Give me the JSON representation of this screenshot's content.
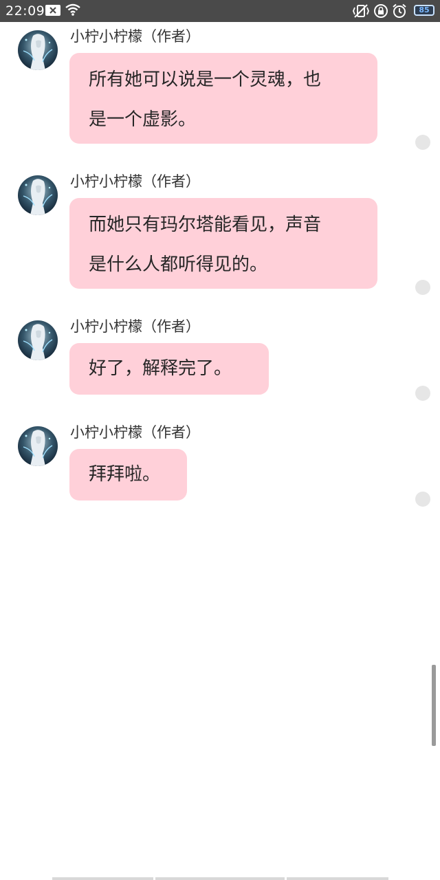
{
  "status_bar": {
    "time": "22:09",
    "battery": "85",
    "icons": [
      "close-box-icon",
      "wifi-icon",
      "vibrate-icon",
      "lock-rotation-icon",
      "alarm-icon",
      "battery-icon"
    ]
  },
  "messages": [
    {
      "sender": "小柠小柠檬（作者）",
      "lines": [
        "所有她可以说是一个灵魂，也",
        "是一个虚影。"
      ]
    },
    {
      "sender": "小柠小柠檬（作者）",
      "lines": [
        "而她只有玛尔塔能看见，声音",
        "是什么人都听得见的。"
      ]
    },
    {
      "sender": "小柠小柠檬（作者）",
      "lines": [
        "好了，解释完了。"
      ]
    },
    {
      "sender": "小柠小柠檬（作者）",
      "lines": [
        "拜拜啦。"
      ]
    }
  ],
  "colors": {
    "bubble": "#ffd0d9",
    "status_bar": "#4a4a4a",
    "read_dot": "#e6e6e6"
  }
}
